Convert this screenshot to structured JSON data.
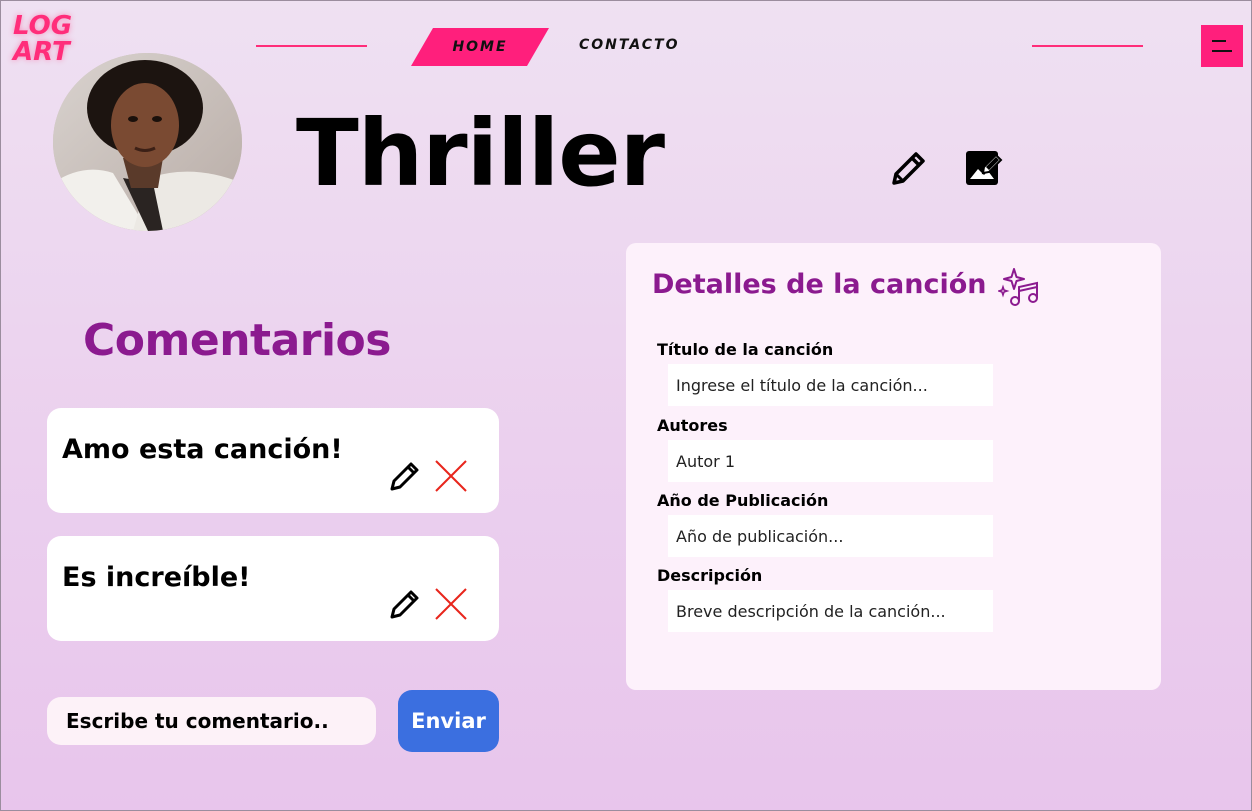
{
  "brand": {
    "logo_line1": "LOG",
    "logo_line2": "ART"
  },
  "nav": {
    "home_label": "HOME",
    "contact_label": "CONTACTO"
  },
  "song": {
    "title": "Thriller",
    "avatar_alt": "Thriller"
  },
  "comments": {
    "heading": "Comentarios",
    "items": [
      {
        "text": "Amo esta canción!"
      },
      {
        "text": "Es increíble!"
      }
    ],
    "input_placeholder": "Escribe tu comentario..",
    "send_label": "Enviar"
  },
  "details": {
    "heading": "Detalles de la canción",
    "fields": [
      {
        "label": "Título de la canción",
        "placeholder": "Ingrese el título de la canción..."
      },
      {
        "label": "Autores",
        "placeholder": "Autor 1"
      },
      {
        "label": "Año de Publicación",
        "placeholder": "Año de publicación..."
      },
      {
        "label": "Descripción",
        "placeholder": "Breve descripción de la canción..."
      }
    ]
  },
  "icons": {
    "menu": "menu-icon",
    "edit": "pencil-icon",
    "edit_image": "edit-image-icon",
    "delete": "close-icon",
    "music": "music-sparkle-icon"
  },
  "colors": {
    "accent_pink": "#ff1f7c",
    "heading_purple": "#8b1a8f",
    "send_blue": "#3b6fe0",
    "delete_red": "#e8261c"
  }
}
